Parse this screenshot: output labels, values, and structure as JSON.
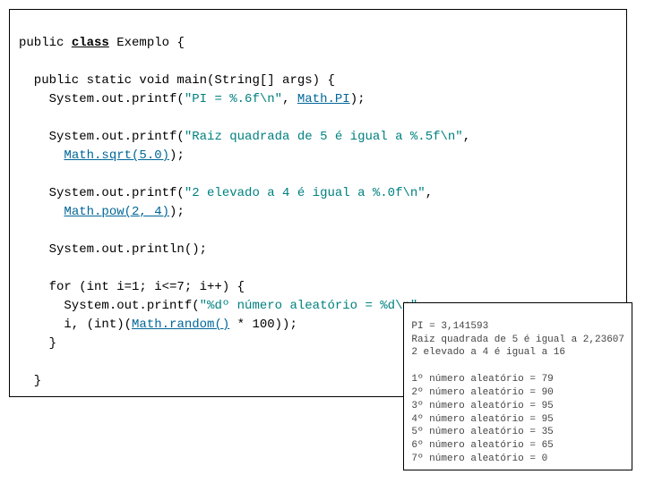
{
  "code": {
    "l1a": "public ",
    "l1b": "class",
    "l1c": " Exemplo {",
    "blank": " ",
    "l3": "  public static void main(String[] args) {",
    "l4a": "    System.out.printf(",
    "l4b": "\"PI = %.6f\\n\"",
    "l4c": ", ",
    "l4d": "Math.PI",
    "l4e": ");",
    "l6a": "    System.out.printf(",
    "l6b": "\"Raiz quadrada de 5 é igual a %.5f\\n\"",
    "l6c": ",",
    "l7a": "      ",
    "l7b": "Math.sqrt(5.0)",
    "l7c": ");",
    "l9a": "    System.out.printf(",
    "l9b": "\"2 elevado a 4 é igual a %.0f\\n\"",
    "l9c": ",",
    "l10a": "      ",
    "l10b": "Math.pow(2, 4)",
    "l10c": ");",
    "l12": "    System.out.println();",
    "l14": "    for (int i=1; i<=7; i++) {",
    "l15a": "      System.out.printf(",
    "l15b": "\"%dº número aleatório = %d\\n\"",
    "l15c": ",",
    "l16a": "      i, (int)(",
    "l16b": "Math.random()",
    "l16c": " * 100));",
    "l17": "    }",
    "l19": "  }"
  },
  "output": {
    "o1": "PI = 3,141593",
    "o2": "Raiz quadrada de 5 é igual a 2,23607",
    "o3": "2 elevado a 4 é igual a 16",
    "o4": "",
    "o5": "1º número aleatório = 79",
    "o6": "2º número aleatório = 90",
    "o7": "3º número aleatório = 95",
    "o8": "4º número aleatório = 95",
    "o9": "5º número aleatório = 35",
    "o10": "6º número aleatório = 65",
    "o11": "7º número aleatório = 0"
  }
}
